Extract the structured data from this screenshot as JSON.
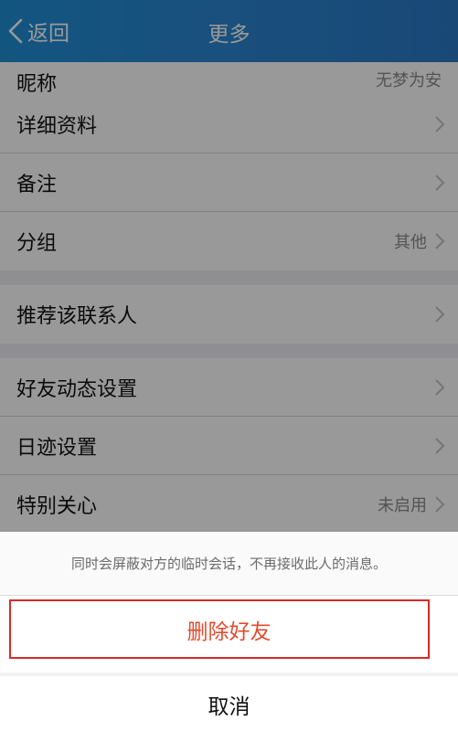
{
  "header": {
    "back_label": "返回",
    "title": "更多",
    "background": "#2a86d2"
  },
  "list": {
    "nickname": {
      "label": "昵称",
      "value": "无梦为安"
    },
    "groups": [
      [
        {
          "label": "详细资料",
          "value": ""
        },
        {
          "label": "备注",
          "value": ""
        },
        {
          "label": "分组",
          "value": "其他"
        }
      ],
      [
        {
          "label": "推荐该联系人",
          "value": ""
        }
      ],
      [
        {
          "label": "好友动态设置",
          "value": ""
        },
        {
          "label": "日迹设置",
          "value": ""
        },
        {
          "label": "特别关心",
          "value": "未启用"
        }
      ]
    ]
  },
  "sheet": {
    "note": "同时会屏蔽对方的临时会话，不再接收此人的消息。",
    "delete_label": "删除好友",
    "cancel_label": "取消",
    "delete_color": "#e24b2e",
    "highlight_color": "#d72a2a"
  },
  "icons": {
    "back": "chevron-left-icon",
    "row": "chevron-right-icon"
  }
}
